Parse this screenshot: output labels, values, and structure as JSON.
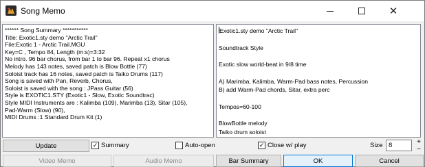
{
  "window": {
    "title": "Song Memo",
    "controls": {
      "minimize": "—",
      "maximize": "☐",
      "close": "✕"
    }
  },
  "summary_lines": [
    "****** Song Summary ***********",
    "Title: Exotic1.sty demo \"Arctic Trail\"",
    "File:Exotic 1 - Arctic Trail.MGU",
    "Key=C , Tempo 84, Length (m:s)=3:32",
    "No intro. 96 bar chorus, from bar 1 to bar 96. Repeat x1 chorus",
    "Melody has 143 notes, saved patch is Blow Bottle (77)",
    "Soloist track has 16 notes, saved patch is Taiko Drums (117)",
    "Song is saved with Pan, Reverb, Chorus,",
    "Soloist is saved with the song : JPass Guitar (56)",
    "Style is EXOTIC1.STY (Exotic1 - Slow, Exotic Soundtrac)",
    "Style MIDI Instruments are : Kalimba (109), Marimba (13), Sitar (105),",
    "Pad-Warm (Slow) (90),",
    "MIDI Drums :1 Standard Drum Kit (1)"
  ],
  "memo_lines": [
    "Exotic1.sty demo \"Arctic Trail\"",
    "",
    "Soundtrack Style",
    "",
    "Exotic slow world-beat in 9/8 time",
    "",
    "A) Marimba, Kalimba, Warm-Pad bass notes, Percussion",
    "B) add Warm-Pad chords, Sitar, extra perc",
    "",
    "Tempos=60-100",
    "",
    "BlowBottle melody",
    "Taiko drum soloist"
  ],
  "controls": {
    "update_label": "Update",
    "summary_label": "Summary",
    "summary_checked": true,
    "autoopen_label": "Auto-open",
    "autoopen_checked": false,
    "closeplay_label": "Close w/ play",
    "closeplay_checked": true,
    "size_label": "Size",
    "size_value": "8",
    "video_memo_label": "Video Memo",
    "audio_memo_label": "Audio Memo",
    "bar_summary_label": "Bar Summary",
    "ok_label": "OK",
    "cancel_label": "Cancel",
    "spin_up": "+",
    "spin_down": "−"
  },
  "colors": {
    "window_bg": "#f0f0f0",
    "accent": "#0078d7",
    "icon_red": "#c0392b"
  }
}
